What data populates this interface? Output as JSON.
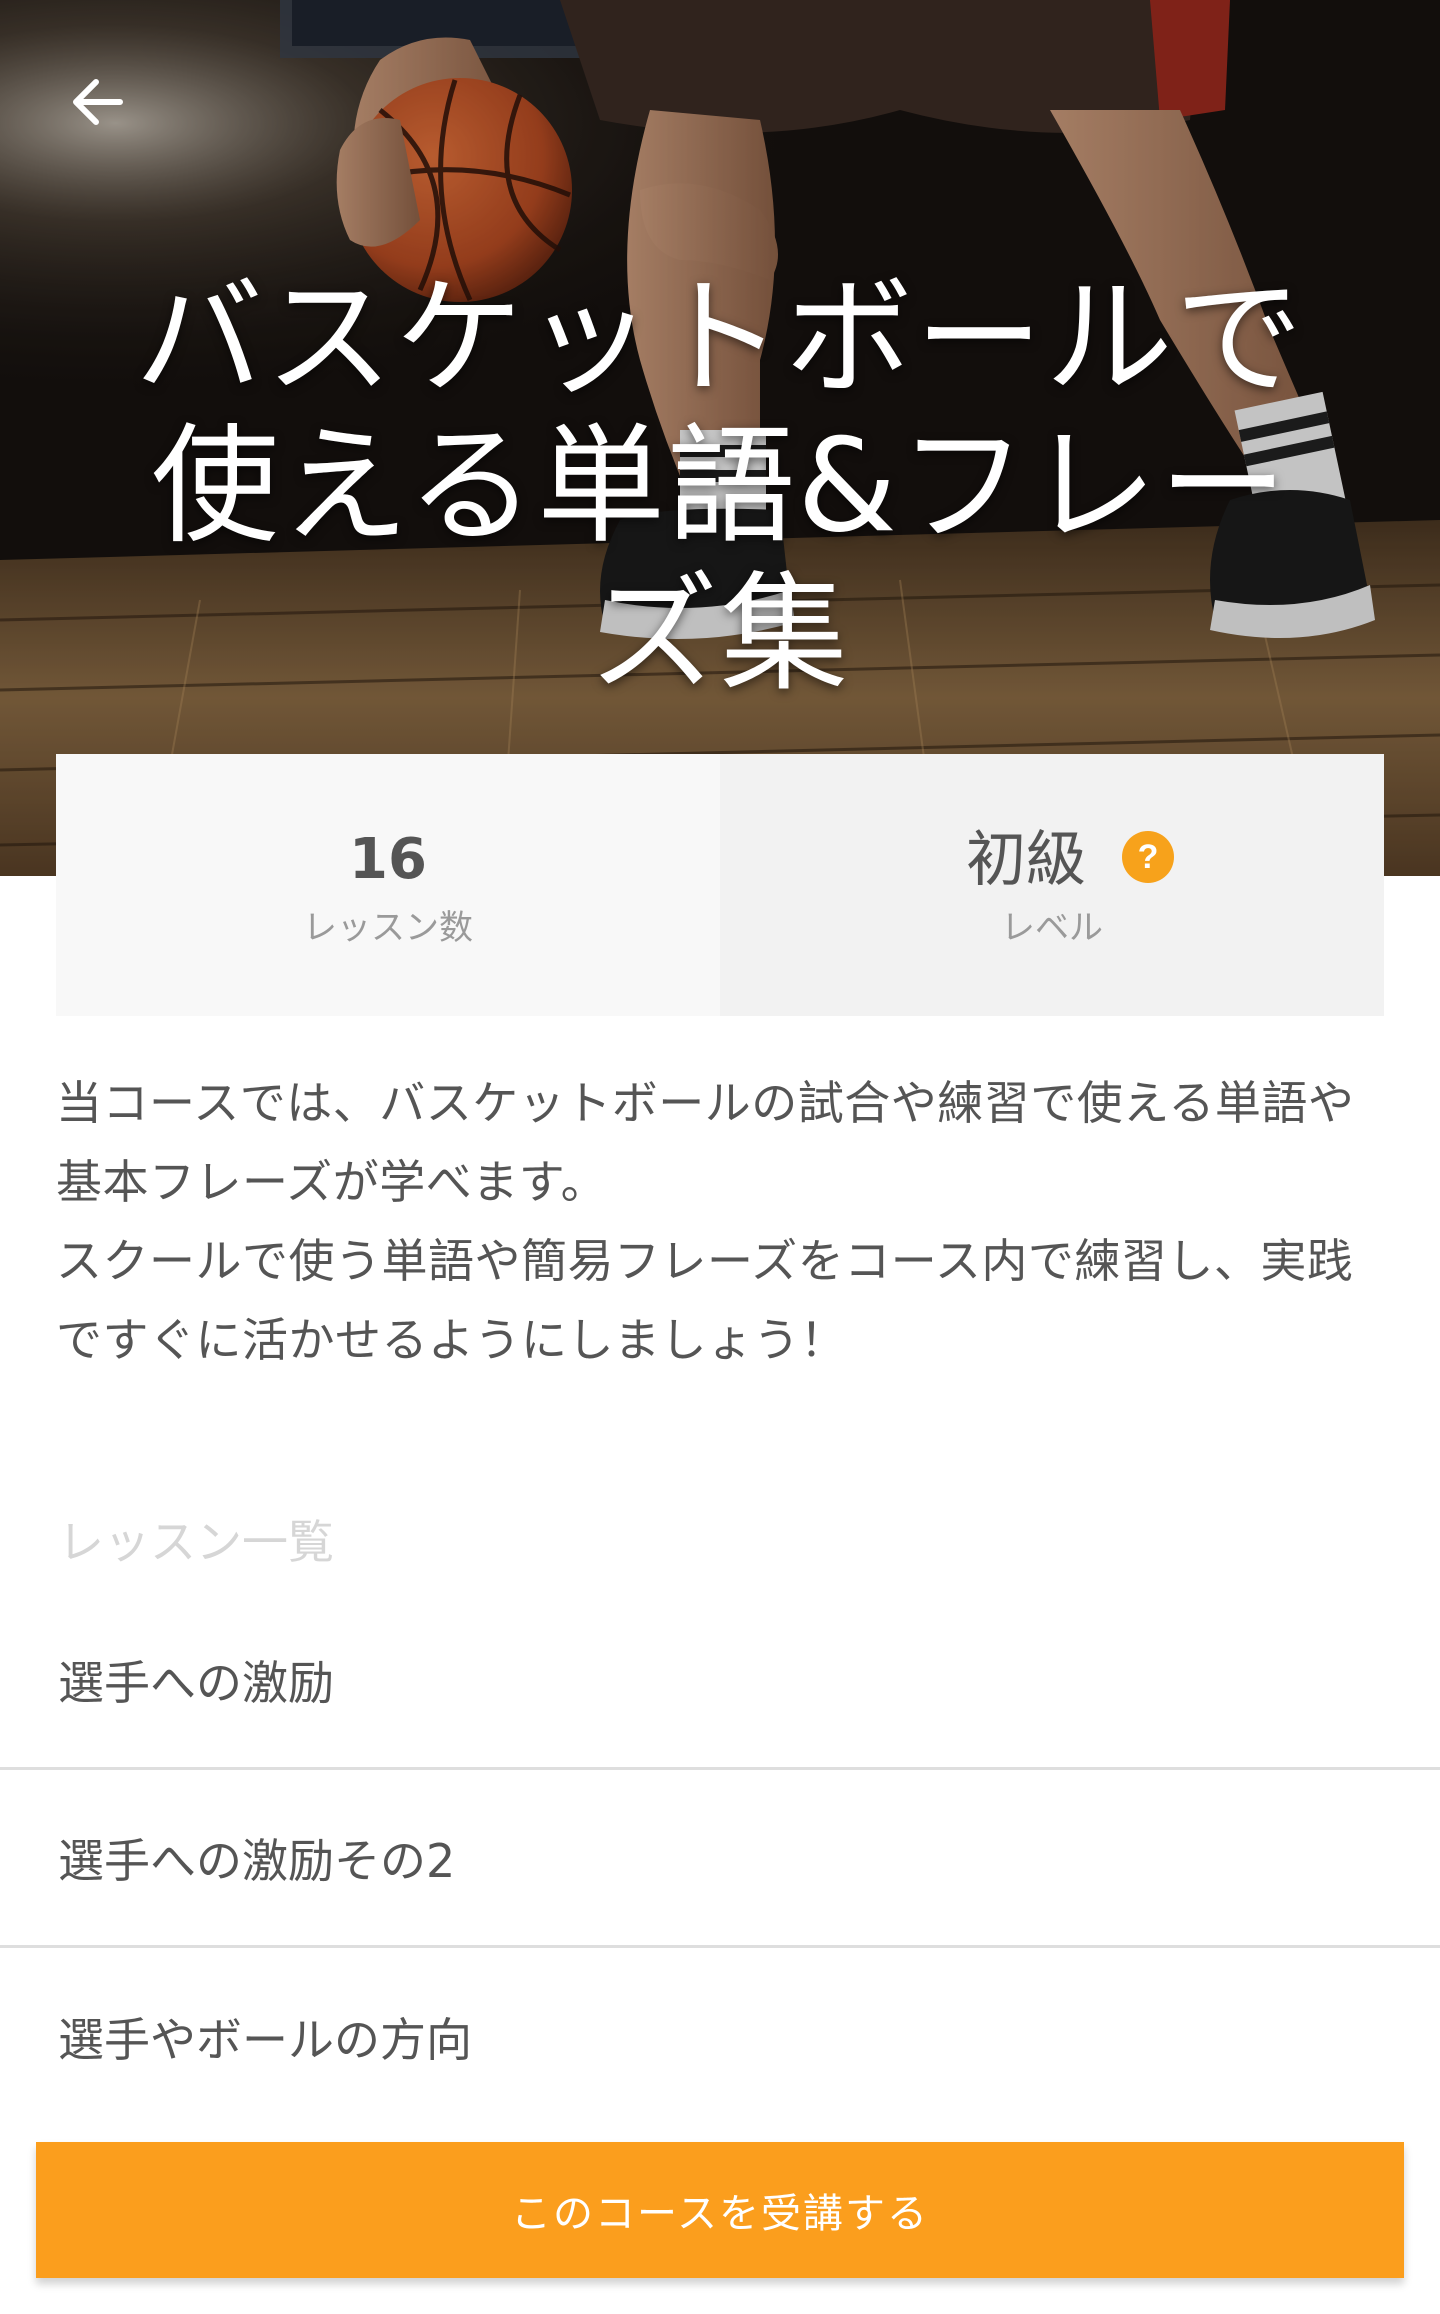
{
  "hero": {
    "title": "バスケットボールで使える単語&フレーズ集",
    "back_icon": "arrow-left-icon"
  },
  "stats": {
    "lessons_value": "16",
    "lessons_label": "レッスン数",
    "level_value": "初級",
    "level_label": "レベル",
    "help_icon": "question-mark-icon",
    "help_symbol": "?"
  },
  "description": "当コースでは、バスケットボールの試合や練習で使える単語や基本フレーズが学べます。\nスクールで使う単語や簡易フレーズをコース内で練習し、実践ですぐに活かせるようにしましょう！",
  "lessons": {
    "heading": "レッスン一覧",
    "items": [
      "選手への激励",
      "選手への激励その2",
      "選手やボールの方向"
    ]
  },
  "cta": {
    "label": "このコースを受講する"
  },
  "colors": {
    "accent": "#fb9e1d",
    "help_badge": "#f7a21b",
    "text_primary": "#555555",
    "text_muted": "#9a9a9a"
  }
}
